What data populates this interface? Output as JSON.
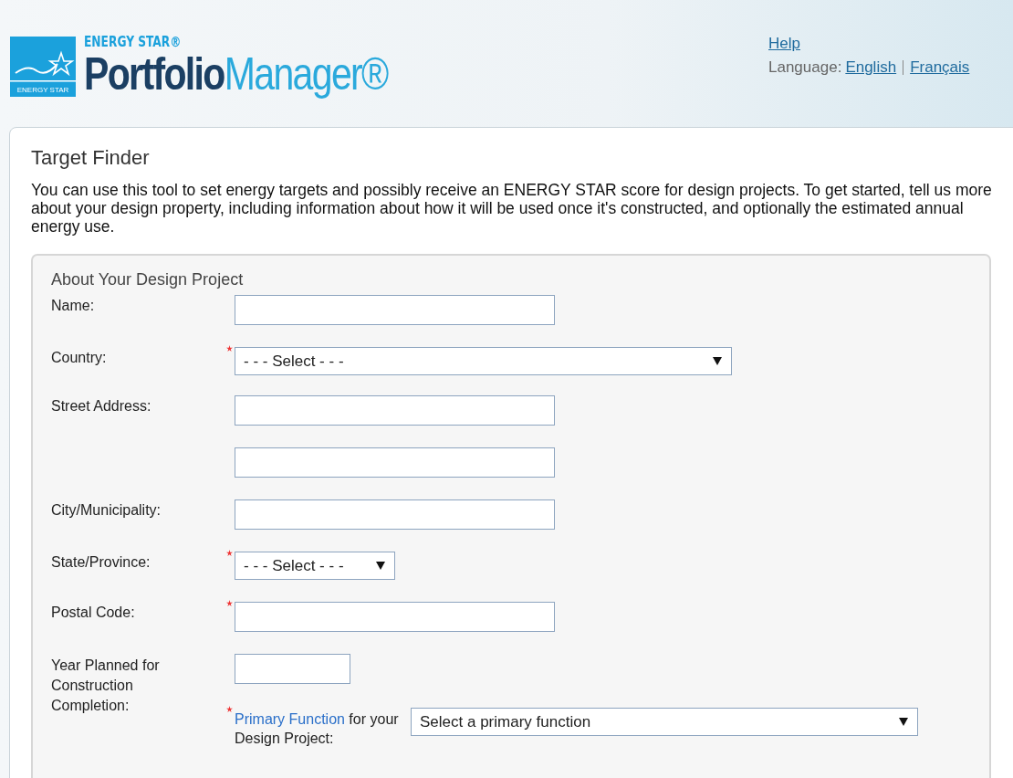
{
  "header": {
    "brand_small": "ENERGY STAR®",
    "brand_bold": "Portfolio",
    "brand_light": "Manager®",
    "logo_text": "ENERGY STAR",
    "help_link": "Help",
    "language_label": "Language:",
    "languages": [
      {
        "label": "English"
      },
      {
        "label": "Français"
      }
    ]
  },
  "page": {
    "title": "Target Finder",
    "intro": "You can use this tool to set energy targets and possibly receive an ENERGY STAR score for design projects. To get started, tell us more about your design property, including information about how it will be used once it's constructed, and optionally the estimated annual energy use."
  },
  "form": {
    "title": "About Your Design Project",
    "rows": [
      {
        "label": "Name:",
        "required": false,
        "kind": "text"
      },
      {
        "label": "Country:",
        "required": true,
        "kind": "select-wide",
        "value": "- - - Select - - -"
      },
      {
        "label": "Street Address:",
        "required": false,
        "kind": "text"
      },
      {
        "required": false,
        "kind": "text"
      },
      {
        "label": "City/Municipality:",
        "required": false,
        "kind": "text"
      },
      {
        "label": "State/Province:",
        "required": true,
        "kind": "select-small",
        "value": "- - - Select - - -"
      },
      {
        "label": "Postal Code:",
        "required": true,
        "kind": "text"
      },
      {
        "label": "Year Planned for Construction Completion:",
        "required": false,
        "kind": "year"
      }
    ],
    "primary_function": {
      "required": true,
      "link": "Primary Function",
      "label_rest": "for your Design Project:",
      "value": "Select a primary function"
    }
  }
}
